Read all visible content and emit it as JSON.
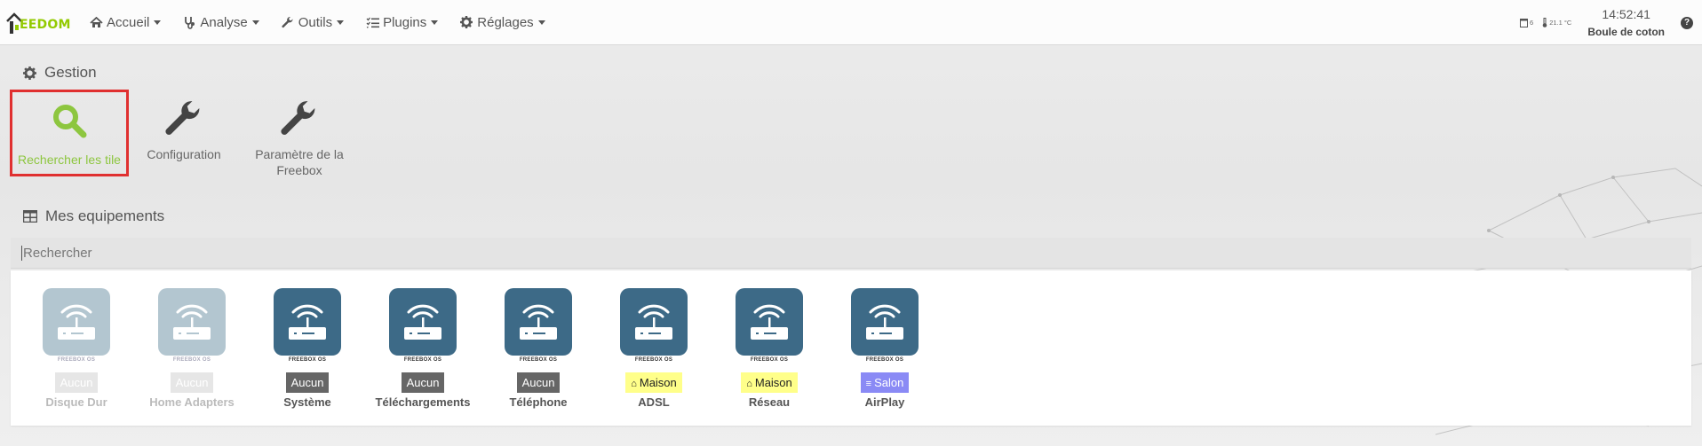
{
  "logo": {
    "text": "EEDOM"
  },
  "nav": [
    {
      "label": "Accueil",
      "icon": "home-icon"
    },
    {
      "label": "Analyse",
      "icon": "stethoscope-icon"
    },
    {
      "label": "Outils",
      "icon": "wrench-icon"
    },
    {
      "label": "Plugins",
      "icon": "tasks-icon"
    },
    {
      "label": "Réglages",
      "icon": "cog-icon"
    }
  ],
  "status": {
    "window_count": "6",
    "temperature": "21.1 °C",
    "time": "14:52:41",
    "profile_name": "Boule de coton",
    "help": "?"
  },
  "gestion": {
    "title": "Gestion",
    "tools": [
      {
        "label": "Rechercher les tile",
        "icon": "search-icon",
        "color": "#8dc63f"
      },
      {
        "label": "Configuration",
        "icon": "wrench-icon"
      },
      {
        "label": "Paramètre de la Freebox",
        "icon": "wrench-icon"
      }
    ]
  },
  "equipements": {
    "title": "Mes equipements",
    "search_placeholder": "Rechercher",
    "brand": "FREEBOX OS",
    "items": [
      {
        "name": "Disque Dur",
        "room": "Aucun",
        "room_type": "none",
        "enabled": false
      },
      {
        "name": "Home Adapters",
        "room": "Aucun",
        "room_type": "none",
        "enabled": false
      },
      {
        "name": "Système",
        "room": "Aucun",
        "room_type": "none",
        "enabled": true
      },
      {
        "name": "Téléchargements",
        "room": "Aucun",
        "room_type": "none",
        "enabled": true
      },
      {
        "name": "Téléphone",
        "room": "Aucun",
        "room_type": "none",
        "enabled": true
      },
      {
        "name": "ADSL",
        "room": "Maison",
        "room_type": "maison",
        "enabled": true
      },
      {
        "name": "Réseau",
        "room": "Maison",
        "room_type": "maison",
        "enabled": true
      },
      {
        "name": "AirPlay",
        "room": "Salon",
        "room_type": "salon",
        "enabled": true
      }
    ]
  },
  "colors": {
    "accent": "#93ca02",
    "card_active": "#3d6a87",
    "card_disabled": "#b3c6d0",
    "highlight_border": "#e03030"
  }
}
